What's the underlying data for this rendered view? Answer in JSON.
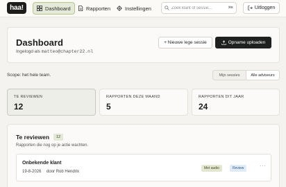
{
  "app": {
    "logo": "haa!"
  },
  "nav": {
    "items": [
      {
        "label": "Dashboard",
        "icon": "grid-icon",
        "active": true
      },
      {
        "label": "Rapporten",
        "icon": "document-icon",
        "active": false
      },
      {
        "label": "Instellingen",
        "icon": "gear-icon",
        "active": false
      }
    ],
    "search": {
      "placeholder": "Zoek klant of sessie...",
      "shortcut": "⌘K"
    },
    "logout_label": "Uitloggen"
  },
  "dashboard": {
    "title": "Dashboard",
    "login_prefix": "Ingelogd als",
    "login_email": "matteo@chapter22.nl",
    "new_session_label": "+ Nieuwe lege sessie",
    "upload_label": "Opname uploaden"
  },
  "scope": {
    "text": "Scope: het hele team.",
    "options": [
      "Mijn sessies",
      "Alle adviseurs"
    ],
    "selected": "Alle adviseurs"
  },
  "stats": [
    {
      "label": "TE REVIEWEN",
      "value": "12"
    },
    {
      "label": "RAPPORTEN DEZE MAAND",
      "value": "5"
    },
    {
      "label": "RAPPORTEN DIT JAAR",
      "value": "24"
    }
  ],
  "review": {
    "title": "Te reviewen",
    "count": "12",
    "subtitle": "Rapporten die nog op je actie wachten.",
    "items": [
      {
        "title": "Onbekende klant",
        "date": "19-8-2026",
        "author": "door Rob Hendrix",
        "tags": [
          "Met audio",
          "Review"
        ],
        "more": "···"
      }
    ]
  },
  "colors": {
    "accent_green_bg": "#e4ead7",
    "accent_green_border": "#b7c58f",
    "dark_button": "#1f2120",
    "review_tag_bg": "#e1ebf5",
    "review_tag_text": "#2d5b86"
  }
}
